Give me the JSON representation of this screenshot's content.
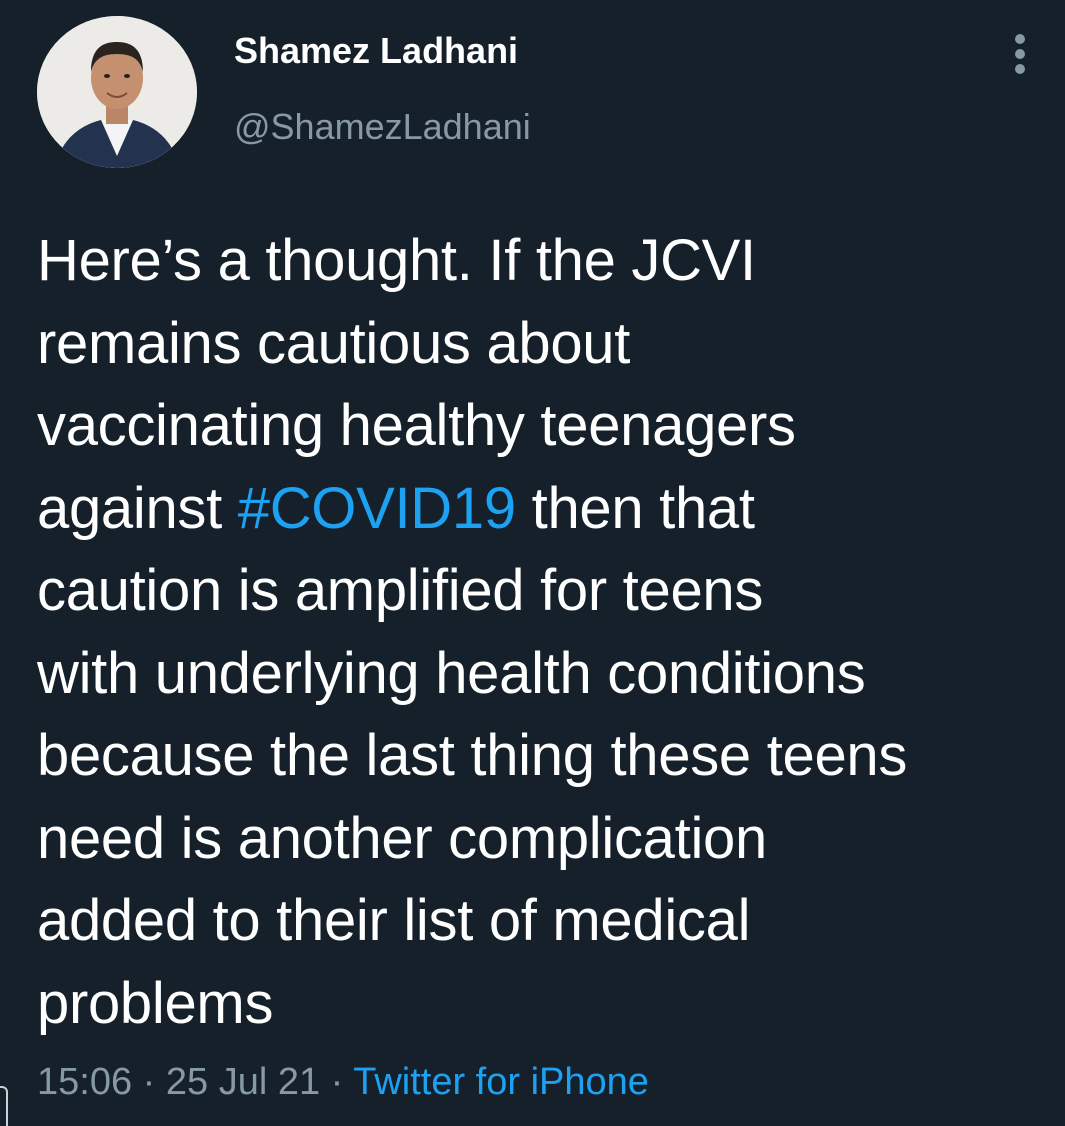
{
  "user": {
    "display_name": "Shamez Ladhani",
    "handle": "@ShamezLadhani"
  },
  "tweet": {
    "lines": [
      [
        {
          "text": "Here’s a thought. If the JCVI"
        }
      ],
      [
        {
          "text": "remains cautious about"
        }
      ],
      [
        {
          "text": "vaccinating healthy teenagers"
        }
      ],
      [
        {
          "text": "against "
        },
        {
          "text": "#COVID19",
          "hashtag": true
        },
        {
          "text": " then that"
        }
      ],
      [
        {
          "text": "caution is amplified for teens"
        }
      ],
      [
        {
          "text": "with underlying health conditions"
        }
      ],
      [
        {
          "text": "because the last thing these teens"
        }
      ],
      [
        {
          "text": "need is another complication"
        }
      ],
      [
        {
          "text": "added to their list of medical"
        }
      ],
      [
        {
          "text": "problems"
        }
      ]
    ]
  },
  "meta": {
    "time": "15:06",
    "separator": "·",
    "date": "25 Jul 21",
    "source": "Twitter for iPhone"
  },
  "icons": {
    "more": "more-vertical-icon"
  },
  "colors": {
    "background": "#15202b",
    "text": "#ffffff",
    "secondary": "#8899a6",
    "link": "#1da1f2"
  }
}
